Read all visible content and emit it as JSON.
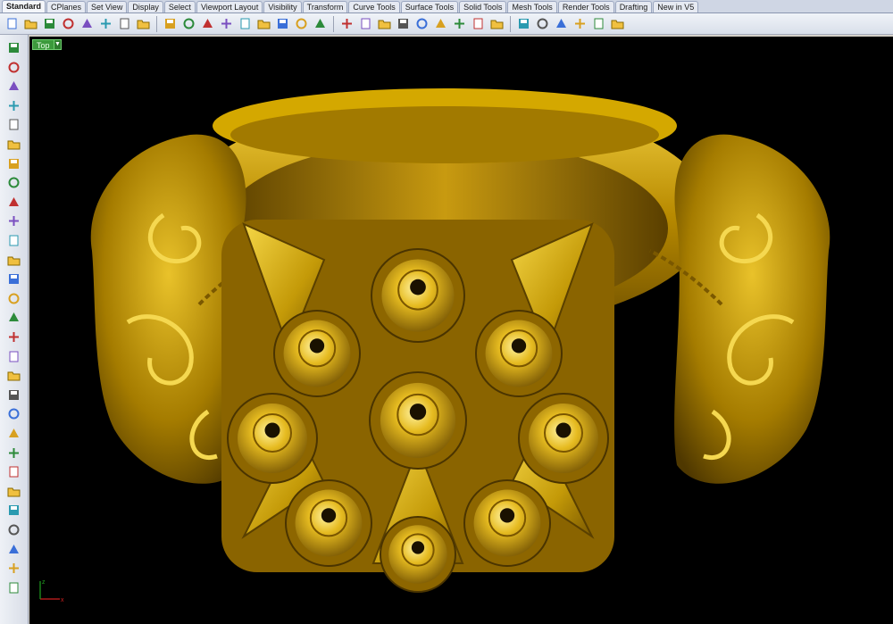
{
  "tabs": [
    "Standard",
    "CPlanes",
    "Set View",
    "Display",
    "Select",
    "Viewport Layout",
    "Visibility",
    "Transform",
    "Curve Tools",
    "Surface Tools",
    "Solid Tools",
    "Mesh Tools",
    "Render Tools",
    "Drafting",
    "New in V5"
  ],
  "active_tab": "Standard",
  "toolbar_icons": [
    "new-file-icon",
    "open-folder-icon",
    "save-icon",
    "print-icon",
    "import-icon",
    "cut-icon",
    "copy-icon",
    "paste-icon",
    "undo-icon",
    "pan-hand-icon",
    "move-icon",
    "zoom-window-icon",
    "zoom-dynamic-icon",
    "zoom-extents-icon",
    "zoom-selected-icon",
    "rotate-view-icon",
    "four-viewports-icon",
    "cplane-icon",
    "ortho-icon",
    "layer-icon",
    "select-icon",
    "lights-icon",
    "properties-icon",
    "paint-icon",
    "color-wheel-icon",
    "render-sphere-icon",
    "render-preview-icon",
    "shaded-sphere-icon",
    "toggle-icon",
    "settings-gear-icon",
    "grid-snap-icon",
    "help-icon"
  ],
  "left_tools": [
    "select-arrow-icon",
    "point-icon",
    "polyline-icon",
    "curve-icon",
    "circle-icon",
    "ellipse-icon",
    "arc-icon",
    "rectangle-icon",
    "polygon-icon",
    "fillet-curve-icon",
    "offset-icon",
    "surface-icon",
    "extrude-icon",
    "solid-box-icon",
    "solid-sphere-icon",
    "cylinder-icon",
    "plane-surface-icon",
    "boolean-icon",
    "mesh-icon",
    "transform-icon",
    "edit-points-icon",
    "dimension-icon",
    "split-icon",
    "text-icon",
    "analyze-icon",
    "grid-icon",
    "block-icon",
    "render-icon",
    "more-icon"
  ],
  "viewport": {
    "name": "Top",
    "background": "#000000",
    "model_color": "#d4a800",
    "axis_x_color": "#d02020",
    "axis_y_color": "#20a020",
    "axis_x_label": "x",
    "axis_y_label": "z"
  },
  "colors": {
    "tab_bar": "#cfd6e4",
    "toolbar": "#e3e8f0",
    "viewport_label_bg": "#3c9a3c"
  }
}
